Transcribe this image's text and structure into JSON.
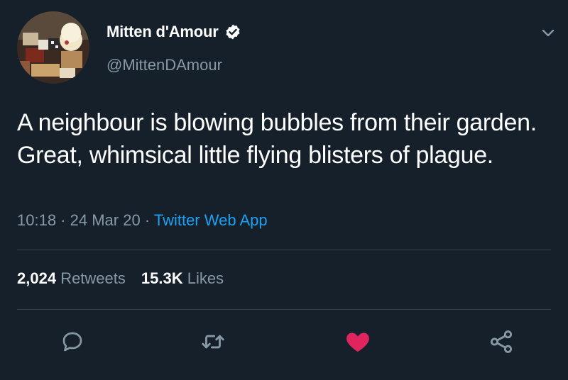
{
  "author": {
    "display_name": "Mitten d'Amour",
    "handle": "@MittenDAmour",
    "verified": true
  },
  "tweet": {
    "text": "A neighbour is blowing bubbles from their garden. Great, whimsical little flying blisters of plague.",
    "time": "10:18",
    "separator": " · ",
    "date": "24 Mar 20",
    "source": "Twitter Web App"
  },
  "stats": {
    "retweets_count": "2,024",
    "retweets_label": "Retweets",
    "likes_count": "15.3K",
    "likes_label": "Likes"
  },
  "actions": [
    {
      "icon": "reply-icon"
    },
    {
      "icon": "retweet-icon"
    },
    {
      "icon": "like-icon",
      "active": true,
      "color": "#e0245e"
    },
    {
      "icon": "share-icon"
    }
  ],
  "colors": {
    "background": "#15202b",
    "secondary_text": "#8899a6",
    "link": "#1da1f2",
    "like_active": "#e0245e",
    "divider": "#38444d"
  }
}
